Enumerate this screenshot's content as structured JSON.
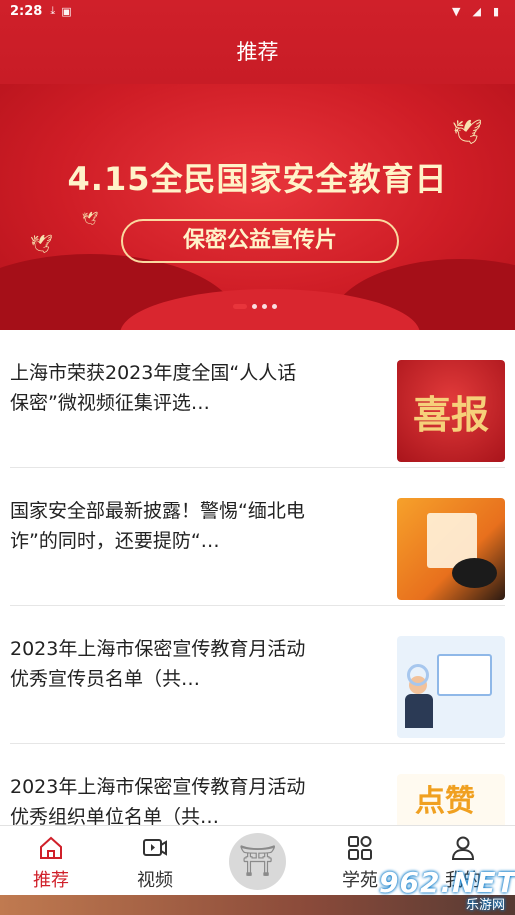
{
  "status_bar": {
    "time": "2:28"
  },
  "header": {
    "title": "推荐"
  },
  "banner": {
    "title": "4.15全民国家安全教育日",
    "subtitle": "保密公益宣传片",
    "slides": 4,
    "active_slide": 1
  },
  "news": [
    {
      "title": "上海市荣获2023年度全国“人人话保密”微视频征集评选…",
      "thumb_text": "喜报"
    },
    {
      "title": "国家安全部最新披露！警惕“缅北电诈”的同时，还要提防“…",
      "thumb_text": ""
    },
    {
      "title": "2023年上海市保密宣传教育月活动优秀宣传员名单（共…",
      "thumb_text": ""
    },
    {
      "title": "2023年上海市保密宣传教育月活动优秀组织单位名单（共…",
      "thumb_text": "点赞"
    }
  ],
  "tabs": {
    "recommend": "推荐",
    "video": "视频",
    "academy": "学苑",
    "profile": "我的"
  },
  "watermark": {
    "big": "962.NET",
    "small": "乐游网"
  },
  "colors": {
    "accent": "#d0202a",
    "banner": "#cf1d26"
  }
}
